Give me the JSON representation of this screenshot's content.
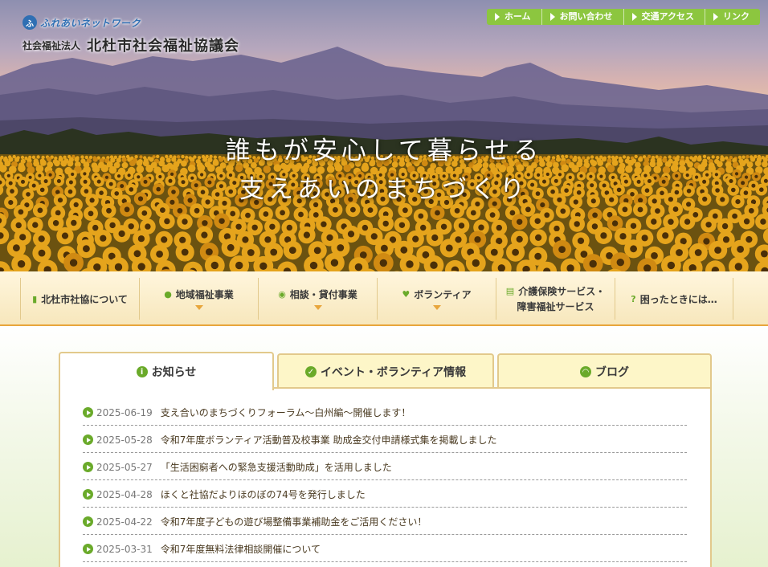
{
  "header": {
    "logo_badge": "ふ",
    "network_label": "ふれあいネットワーク",
    "org_prefix": "社会福祉法人",
    "org_name": "北杜市社会福祉協議会"
  },
  "top_nav": [
    {
      "label": "ホーム",
      "icon": "arrow-right-icon"
    },
    {
      "label": "お問い合わせ",
      "icon": "arrow-right-icon"
    },
    {
      "label": "交通アクセス",
      "icon": "arrow-right-icon"
    },
    {
      "label": "リンク",
      "icon": "arrow-right-icon"
    }
  ],
  "hero": {
    "tagline_1": "誰もが安心して暮らせる",
    "tagline_2": "支えあいのまちづくり"
  },
  "main_nav": [
    {
      "label": "北杜市社協について",
      "label2": "",
      "icon": "document-icon",
      "glyph": "▮",
      "has_dropdown": false
    },
    {
      "label": "地域福祉事業",
      "label2": "",
      "icon": "people-icon",
      "glyph": "●",
      "has_dropdown": true
    },
    {
      "label": "相談・貸付事業",
      "label2": "",
      "icon": "chat-icon",
      "glyph": "◉",
      "has_dropdown": true
    },
    {
      "label": "ボランティア",
      "label2": "",
      "icon": "heart-icon",
      "glyph": "♥",
      "has_dropdown": true
    },
    {
      "label": "介護保険サービス・",
      "label2": "障害福祉サービス",
      "icon": "book-icon",
      "glyph": "▤",
      "has_dropdown": false
    },
    {
      "label": "困ったときには…",
      "label2": "",
      "icon": "question-icon",
      "glyph": "?",
      "has_dropdown": false
    }
  ],
  "tabs": [
    {
      "label": "お知らせ",
      "icon": "info-icon",
      "glyph": "i",
      "active": true
    },
    {
      "label": "イベント・ボランティア情報",
      "icon": "check-icon",
      "glyph": "✓",
      "active": false
    },
    {
      "label": "ブログ",
      "icon": "rss-icon",
      "glyph": "◠",
      "active": false
    }
  ],
  "news": [
    {
      "date": "2025-06-19",
      "title": "支え合いのまちづくりフォーラム～白州編～開催します！"
    },
    {
      "date": "2025-05-28",
      "title": "令和7年度ボランティア活動普及校事業 助成金交付申請様式集を掲載しました"
    },
    {
      "date": "2025-05-27",
      "title": "「生活困窮者への緊急支援活動助成」を活用しました"
    },
    {
      "date": "2025-04-28",
      "title": "ほくと社協だよりほのぼの74号を発行しました"
    },
    {
      "date": "2025-04-22",
      "title": "令和7年度子どもの遊び場整備事業補助金をご活用ください！"
    },
    {
      "date": "2025-03-31",
      "title": "令和7年度無料法律相談開催について"
    }
  ],
  "colors": {
    "accent_green": "#8cc63f",
    "icon_green": "#6aaa2a",
    "nav_orange": "#e8a63c",
    "tab_border": "#e2c98c"
  }
}
